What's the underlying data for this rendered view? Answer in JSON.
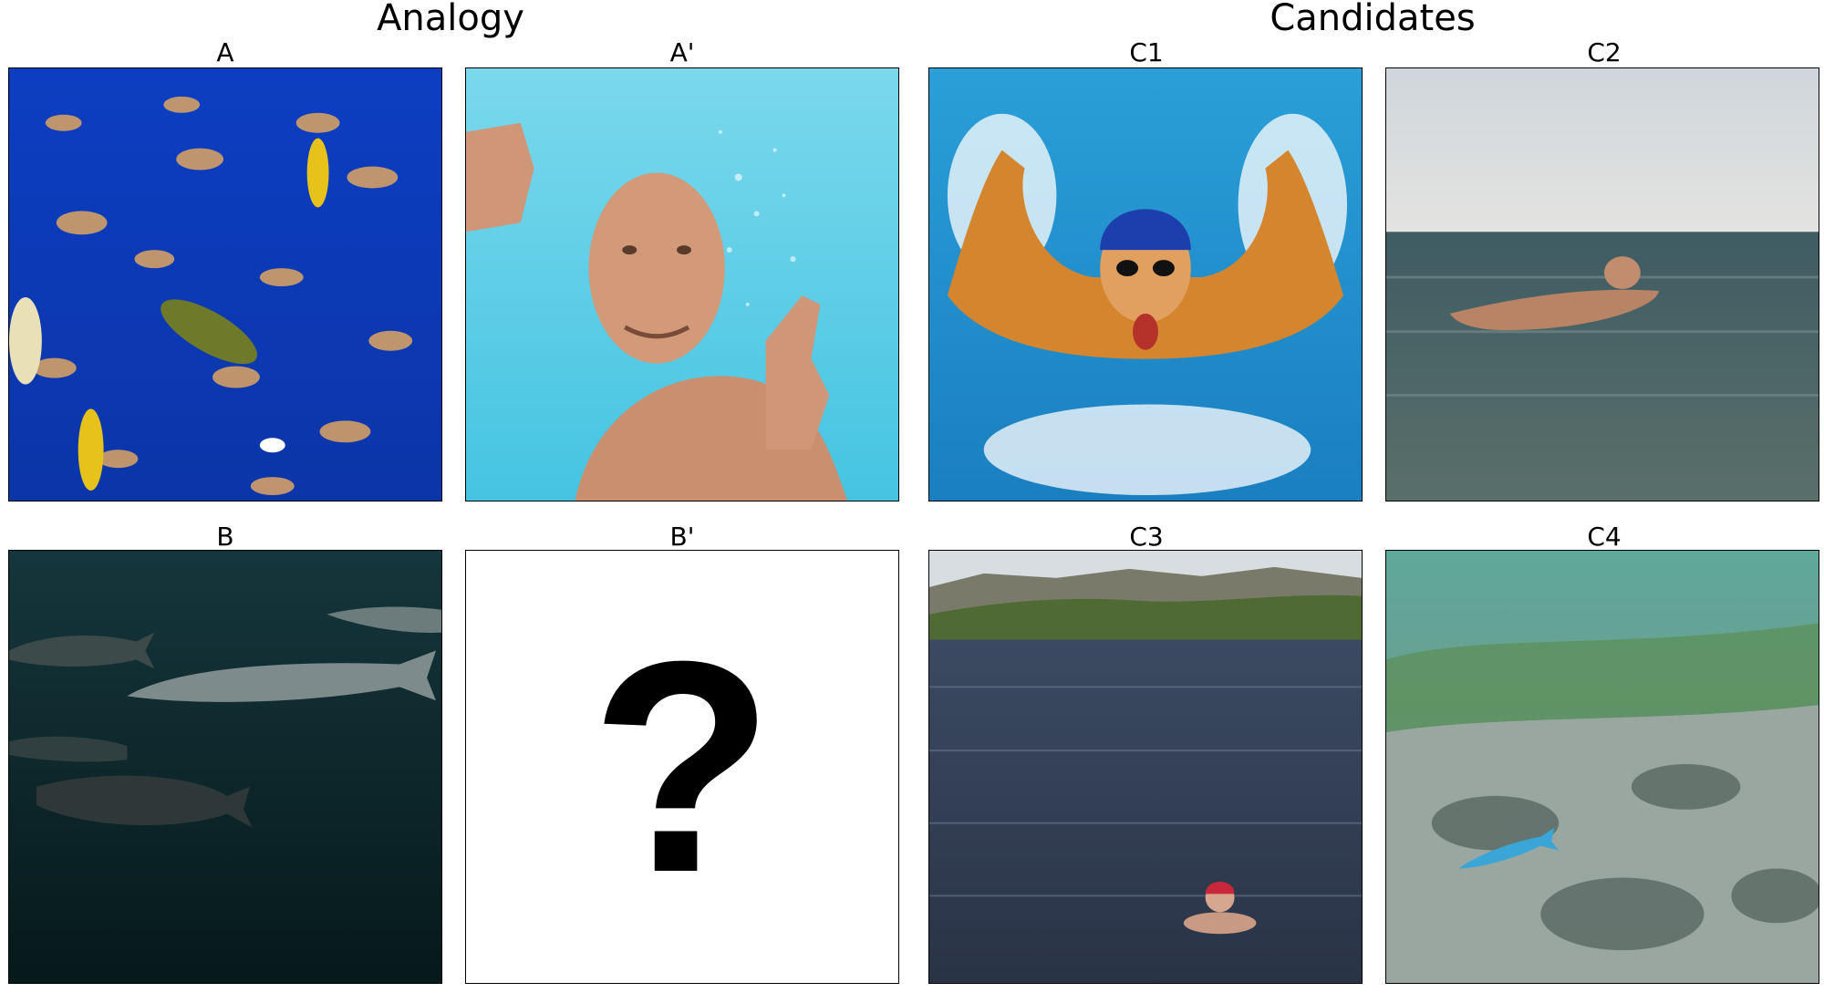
{
  "headers": {
    "analogy": "Analogy",
    "candidates": "Candidates"
  },
  "panels": {
    "a": "A",
    "a_prime": "A'",
    "b": "B",
    "b_prime": "B'",
    "c1": "C1",
    "c2": "C2",
    "c3": "C3",
    "c4": "C4"
  },
  "placeholder": {
    "question_mark": "?"
  },
  "images": {
    "a": "fish-school-image",
    "a_prime": "underwater-man-thumbs-up-image",
    "b": "sharks-dark-water-image",
    "c1": "butterfly-swimmer-image",
    "c2": "man-floating-sea-image",
    "c3": "lake-swimmer-red-cap-image",
    "c4": "reef-fish-image"
  },
  "colors": {
    "frame": "#000000",
    "background": "#ffffff"
  }
}
